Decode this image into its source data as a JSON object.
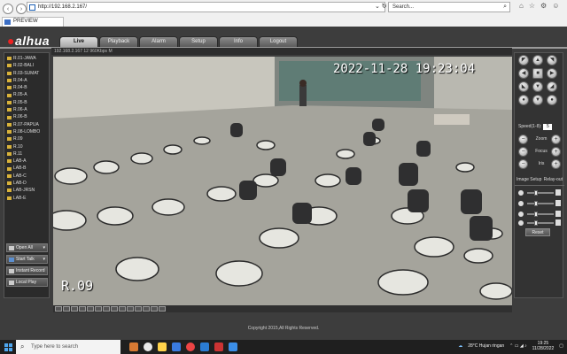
{
  "browser": {
    "url": "http://192.168.2.167/",
    "search_placeholder": "Search...",
    "tab_title": "PREVIEW"
  },
  "app": {
    "logo": "alhua",
    "nav": [
      "Live",
      "Playback",
      "Alarm",
      "Setup",
      "Info",
      "Logout"
    ],
    "active_nav": "Live",
    "cameras": [
      "R.01-JAWA",
      "R.02-BALI",
      "R.03-SUMAT",
      "R.04-A",
      "R.04-B",
      "R.05-A",
      "R.05-B",
      "R.06-A",
      "R.06-B",
      "R.07-PAPUA",
      "R.08-LOMBO",
      "R.09",
      "R.10",
      "R.11",
      "LAB-A",
      "LAB-B",
      "LAB-C",
      "LAB-D",
      "LAB-JRSN",
      "LAB-E"
    ],
    "buttons": [
      {
        "label": "Open All",
        "arrow": "▾"
      },
      {
        "label": "Start Talk",
        "arrow": "▾"
      },
      {
        "label": "Instant Record",
        "arrow": ""
      },
      {
        "label": "Local Play",
        "arrow": ""
      }
    ],
    "video_header": "192.168.2.167  12  960Kbps  M",
    "video_timestamp": "2022-11-28  19:23:04",
    "video_label": "R.09",
    "ptz": {
      "speed_label": "Speed(1-8):",
      "speed_value": "5",
      "zoom": "Zoom",
      "focus": "Focus",
      "iris": "Iris"
    },
    "image_tabs": [
      "Image Setup",
      "Relay-out"
    ],
    "reset": "Reset",
    "footer": "Copyright 2015,All Rights Reserved."
  },
  "taskbar": {
    "search_placeholder": "Type here to search",
    "weather": "28°C  Hujan ringan",
    "time": "19:25",
    "date": "11/28/2022"
  }
}
